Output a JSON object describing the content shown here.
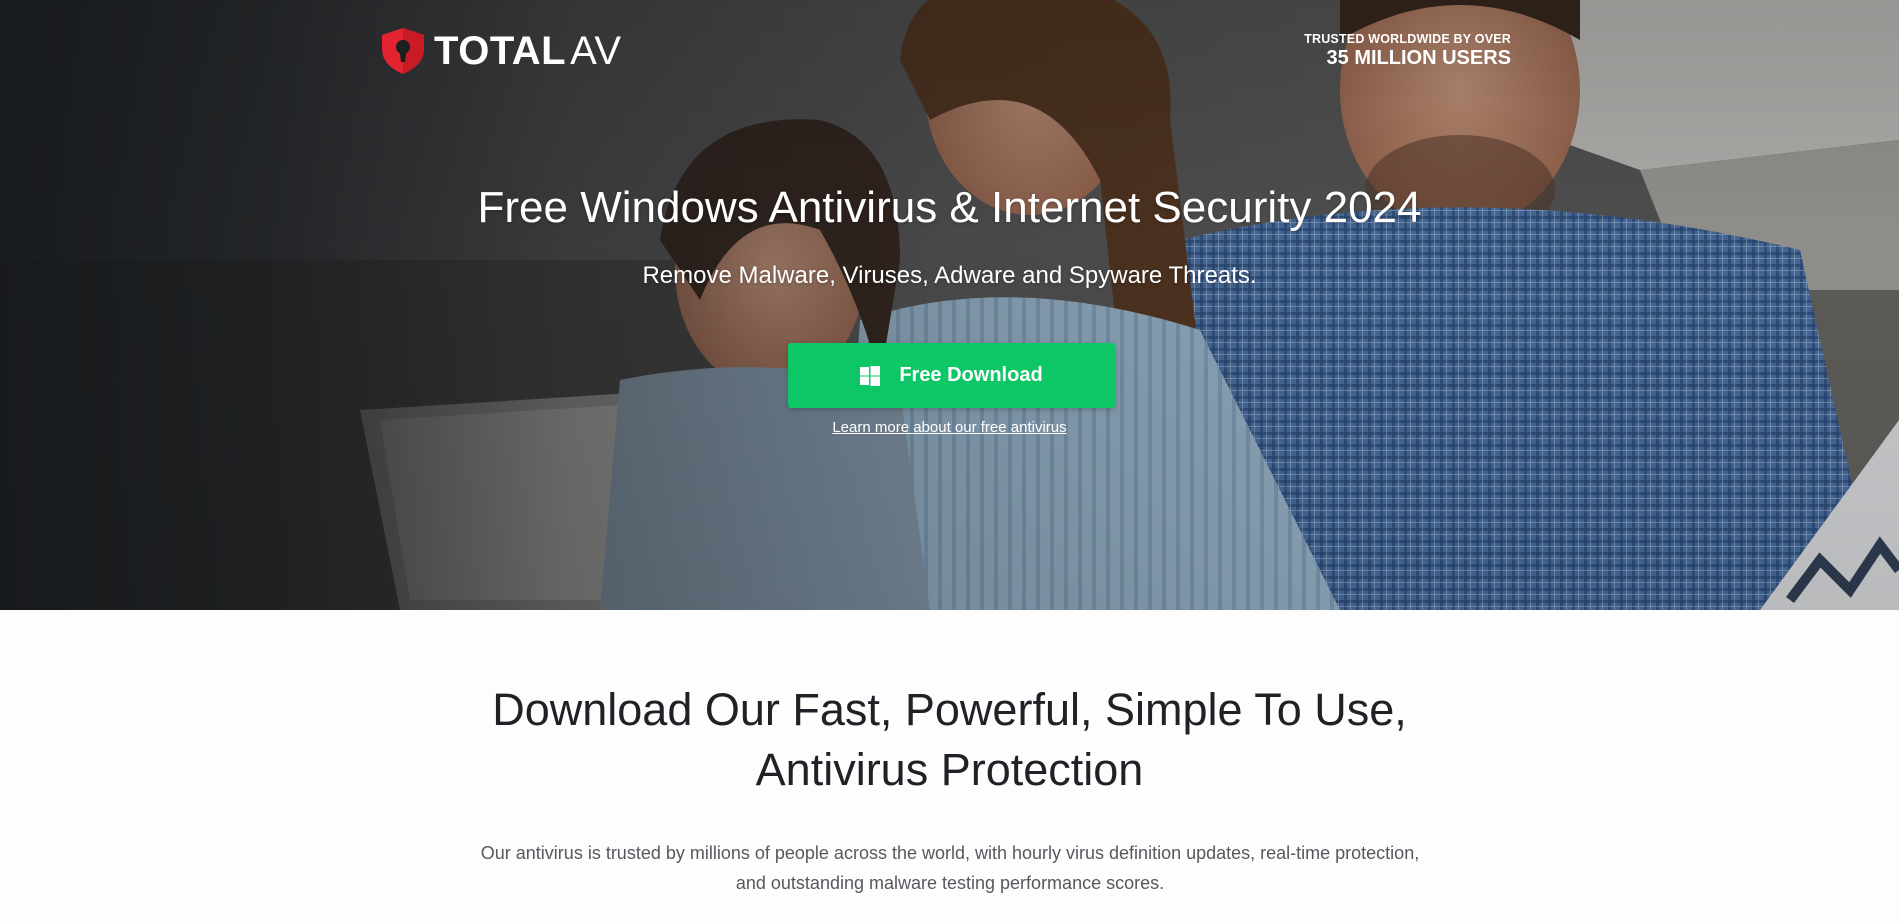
{
  "header": {
    "brand_bold": "TOTAL",
    "brand_light": "AV",
    "trust_line_1": "TRUSTED WORLDWIDE BY OVER",
    "trust_line_2": "35 MILLION USERS"
  },
  "hero": {
    "title": "Free Windows Antivirus & Internet Security 2024",
    "subtitle": "Remove Malware, Viruses, Adware and Spyware Threats.",
    "download_label": "Free Download",
    "learn_more_label": "Learn more about our free antivirus"
  },
  "intro": {
    "title_line_1": "Download Our Fast, Powerful, Simple To Use,",
    "title_line_2": "Antivirus Protection",
    "body_line_1": "Our antivirus is trusted by millions of people across the world, with hourly virus definition updates, real-time protection,",
    "body_line_2": "and outstanding malware testing performance scores."
  },
  "colors": {
    "accent_green": "#0dc766",
    "logo_red": "#e3232f",
    "text_dark": "#1e2226",
    "text_muted": "#55595e"
  },
  "icons": {
    "logo": "shield-keyhole-icon",
    "download": "windows-icon"
  }
}
